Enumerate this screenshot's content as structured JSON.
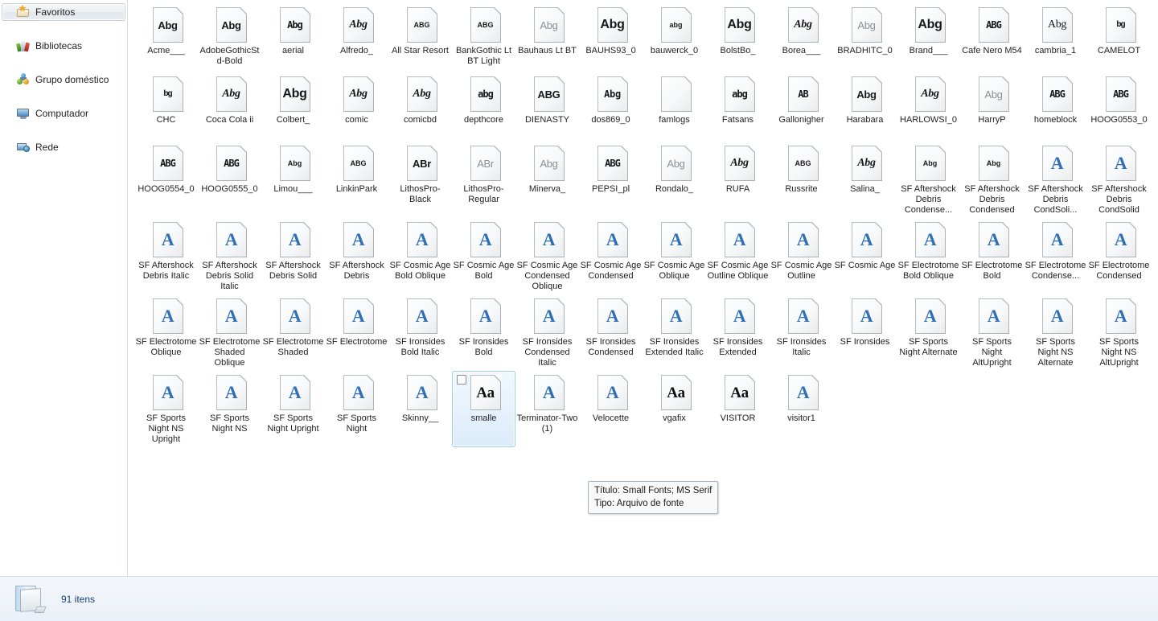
{
  "nav": {
    "items": [
      {
        "label": "Favoritos",
        "icon": "favorites-icon",
        "selected": true
      },
      {
        "label": "Bibliotecas",
        "icon": "libraries-icon",
        "selected": false
      },
      {
        "label": "Grupo doméstico",
        "icon": "homegroup-icon",
        "selected": false
      },
      {
        "label": "Computador",
        "icon": "computer-icon",
        "selected": false
      },
      {
        "label": "Rede",
        "icon": "network-icon",
        "selected": false
      }
    ]
  },
  "tooltip": {
    "line1": "Título: Small Fonts; MS Serif",
    "line2": "Tipo: Arquivo de fonte"
  },
  "status": {
    "icon": "folder-icon",
    "text": "91 itens"
  },
  "files": [
    {
      "label": "Acme___",
      "sample": "Abg",
      "style": ""
    },
    {
      "label": "AdobeGothicStd-Bold",
      "sample": "Abg",
      "style": ""
    },
    {
      "label": "aerial",
      "sample": "Abg",
      "style": "blocky"
    },
    {
      "label": "Alfredo_",
      "sample": "Abg",
      "style": "script"
    },
    {
      "label": "All Star Resort",
      "sample": "ABG",
      "style": "tiny"
    },
    {
      "label": "BankGothic Lt BT Light",
      "sample": "ABG",
      "style": "tiny"
    },
    {
      "label": "Bauhaus Lt BT",
      "sample": "Abg",
      "style": "thin"
    },
    {
      "label": "BAUHS93_0",
      "sample": "Abg",
      "style": "big"
    },
    {
      "label": "bauwerck_0",
      "sample": "abg",
      "style": "tiny"
    },
    {
      "label": "BolstBo_",
      "sample": "Abg",
      "style": "big"
    },
    {
      "label": "Borea___",
      "sample": "Abg",
      "style": "script"
    },
    {
      "label": "BRADHITC_0",
      "sample": "Abg",
      "style": "thin"
    },
    {
      "label": "Brand___",
      "sample": "Abg",
      "style": "big"
    },
    {
      "label": "Cafe Nero M54",
      "sample": "ABG",
      "style": "blocky"
    },
    {
      "label": "cambria_1",
      "sample": "Abg",
      "style": "serif"
    },
    {
      "label": "CAMELOT",
      "sample": "bg",
      "style": "noise"
    },
    {
      "label": "CHC",
      "sample": "bg",
      "style": "noise"
    },
    {
      "label": "Coca Cola ii",
      "sample": "Abg",
      "style": "script"
    },
    {
      "label": "Colbert_",
      "sample": "Abg",
      "style": "big"
    },
    {
      "label": "comic",
      "sample": "Abg",
      "style": "script"
    },
    {
      "label": "comicbd",
      "sample": "Abg",
      "style": "script"
    },
    {
      "label": "depthcore",
      "sample": "abg",
      "style": "blocky"
    },
    {
      "label": "DIENASTY",
      "sample": "ABG",
      "style": ""
    },
    {
      "label": "dos869_0",
      "sample": "Abg",
      "style": "mono"
    },
    {
      "label": "famlogs",
      "sample": "",
      "style": "noise"
    },
    {
      "label": "Fatsans",
      "sample": "abg",
      "style": "blocky"
    },
    {
      "label": "Gallonigher",
      "sample": "AB",
      "style": "blocky"
    },
    {
      "label": "Harabara",
      "sample": "Abg",
      "style": ""
    },
    {
      "label": "HARLOWSI_0",
      "sample": "Abg",
      "style": "script"
    },
    {
      "label": "HarryP",
      "sample": "Abg",
      "style": "thin"
    },
    {
      "label": "homeblock",
      "sample": "ABG",
      "style": "blocky"
    },
    {
      "label": "HOOG0553_0",
      "sample": "ABG",
      "style": "blocky"
    },
    {
      "label": "HOOG0554_0",
      "sample": "ABG",
      "style": "blocky"
    },
    {
      "label": "HOOG0555_0",
      "sample": "ABG",
      "style": "blocky"
    },
    {
      "label": "Limou___",
      "sample": "Abg",
      "style": "tiny"
    },
    {
      "label": "LinkinPark",
      "sample": "ABG",
      "style": "tiny"
    },
    {
      "label": "LithosPro-Black",
      "sample": "ABr",
      "style": ""
    },
    {
      "label": "LithosPro-Regular",
      "sample": "ABr",
      "style": "thin"
    },
    {
      "label": "Minerva_",
      "sample": "Abg",
      "style": "thin"
    },
    {
      "label": "PEPSI_pl",
      "sample": "ABG",
      "style": "blocky"
    },
    {
      "label": "Rondalo_",
      "sample": "Abg",
      "style": "thin"
    },
    {
      "label": "RUFA",
      "sample": "Abg",
      "style": "script"
    },
    {
      "label": "Russrite",
      "sample": "ABG",
      "style": "tiny"
    },
    {
      "label": "Salina_",
      "sample": "Abg",
      "style": "script"
    },
    {
      "label": "SF Aftershock Debris Condense...",
      "sample": "Abg",
      "style": "tiny"
    },
    {
      "label": "SF Aftershock Debris Condensed",
      "sample": "Abg",
      "style": "tiny"
    },
    {
      "label": "SF Aftershock Debris CondSoli...",
      "sample": "A",
      "style": "otf"
    },
    {
      "label": "SF Aftershock Debris CondSolid",
      "sample": "A",
      "style": "otf"
    },
    {
      "label": "SF Aftershock Debris Italic",
      "sample": "A",
      "style": "otf"
    },
    {
      "label": "SF Aftershock Debris Solid Italic",
      "sample": "A",
      "style": "otf"
    },
    {
      "label": "SF Aftershock Debris Solid",
      "sample": "A",
      "style": "otf"
    },
    {
      "label": "SF Aftershock Debris",
      "sample": "A",
      "style": "otf"
    },
    {
      "label": "SF Cosmic Age Bold Oblique",
      "sample": "A",
      "style": "otf"
    },
    {
      "label": "SF Cosmic Age Bold",
      "sample": "A",
      "style": "otf"
    },
    {
      "label": "SF Cosmic Age Condensed Oblique",
      "sample": "A",
      "style": "otf"
    },
    {
      "label": "SF Cosmic Age Condensed",
      "sample": "A",
      "style": "otf"
    },
    {
      "label": "SF Cosmic Age Oblique",
      "sample": "A",
      "style": "otf"
    },
    {
      "label": "SF Cosmic Age Outline Oblique",
      "sample": "A",
      "style": "otf"
    },
    {
      "label": "SF Cosmic Age Outline",
      "sample": "A",
      "style": "otf"
    },
    {
      "label": "SF Cosmic Age",
      "sample": "A",
      "style": "otf"
    },
    {
      "label": "SF Electrotome Bold Oblique",
      "sample": "A",
      "style": "otf"
    },
    {
      "label": "SF Electrotome Bold",
      "sample": "A",
      "style": "otf"
    },
    {
      "label": "SF Electrotome Condense...",
      "sample": "A",
      "style": "otf"
    },
    {
      "label": "SF Electrotome Condensed",
      "sample": "A",
      "style": "otf"
    },
    {
      "label": "SF Electrotome Oblique",
      "sample": "A",
      "style": "otf"
    },
    {
      "label": "SF Electrotome Shaded Oblique",
      "sample": "A",
      "style": "otf"
    },
    {
      "label": "SF Electrotome Shaded",
      "sample": "A",
      "style": "otf"
    },
    {
      "label": "SF Electrotome",
      "sample": "A",
      "style": "otf"
    },
    {
      "label": "SF Ironsides Bold Italic",
      "sample": "A",
      "style": "otf"
    },
    {
      "label": "SF Ironsides Bold",
      "sample": "A",
      "style": "otf"
    },
    {
      "label": "SF Ironsides Condensed Italic",
      "sample": "A",
      "style": "otf"
    },
    {
      "label": "SF Ironsides Condensed",
      "sample": "A",
      "style": "otf"
    },
    {
      "label": "SF Ironsides Extended Italic",
      "sample": "A",
      "style": "otf"
    },
    {
      "label": "SF Ironsides Extended",
      "sample": "A",
      "style": "otf"
    },
    {
      "label": "SF Ironsides Italic",
      "sample": "A",
      "style": "otf"
    },
    {
      "label": "SF Ironsides",
      "sample": "A",
      "style": "otf"
    },
    {
      "label": "SF Sports Night Alternate",
      "sample": "A",
      "style": "otf"
    },
    {
      "label": "SF Sports Night AltUpright",
      "sample": "A",
      "style": "otf"
    },
    {
      "label": "SF Sports Night NS Alternate",
      "sample": "A",
      "style": "otf"
    },
    {
      "label": "SF Sports Night NS AltUpright",
      "sample": "A",
      "style": "otf"
    },
    {
      "label": "SF Sports Night NS Upright",
      "sample": "A",
      "style": "otf"
    },
    {
      "label": "SF Sports Night NS",
      "sample": "A",
      "style": "otf"
    },
    {
      "label": "SF Sports Night Upright",
      "sample": "A",
      "style": "otf"
    },
    {
      "label": "SF Sports Night",
      "sample": "A",
      "style": "otf"
    },
    {
      "label": "Skinny__",
      "sample": "A",
      "style": "otf"
    },
    {
      "label": "smalle",
      "sample": "Aa",
      "style": "aa",
      "selected": true
    },
    {
      "label": "Terminator-Two (1)",
      "sample": "A",
      "style": "otf"
    },
    {
      "label": "Velocette",
      "sample": "A",
      "style": "otf"
    },
    {
      "label": "vgafix",
      "sample": "Aa",
      "style": "aa"
    },
    {
      "label": "VISITOR",
      "sample": "Aa",
      "style": "aa"
    },
    {
      "label": "visitor1",
      "sample": "A",
      "style": "otf"
    }
  ]
}
